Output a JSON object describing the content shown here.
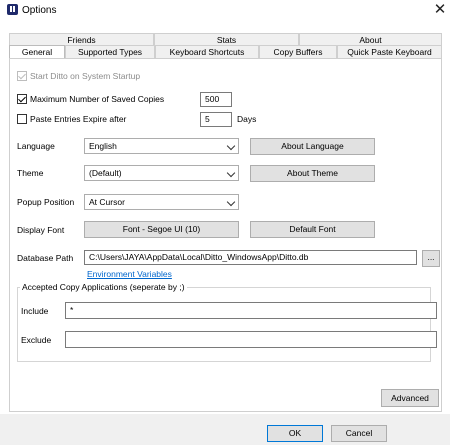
{
  "window": {
    "title": "Options",
    "close_glyph": "✕"
  },
  "tabs_row1": [
    "Friends",
    "Stats",
    "About"
  ],
  "tabs_row2": [
    "General",
    "Supported Types",
    "Keyboard Shortcuts",
    "Copy Buffers",
    "Quick Paste Keyboard"
  ],
  "active_tab": "General",
  "general": {
    "start_on_startup": {
      "label": "Start Ditto on System Startup",
      "checked": true,
      "disabled": true
    },
    "max_saved": {
      "label": "Maximum Number of Saved Copies",
      "checked": true,
      "value": "500"
    },
    "expire": {
      "label": "Paste Entries Expire after",
      "checked": false,
      "value": "5",
      "unit": "Days"
    },
    "language": {
      "label": "Language",
      "value": "English",
      "button": "About Language"
    },
    "theme": {
      "label": "Theme",
      "value": "(Default)",
      "button": "About Theme"
    },
    "popup": {
      "label": "Popup Position",
      "value": "At Cursor"
    },
    "font": {
      "label": "Display Font",
      "value": "Font - Segoe UI (10)",
      "button": "Default Font"
    },
    "db": {
      "label": "Database Path",
      "value": "C:\\Users\\JAYA\\AppData\\Local\\Ditto_WindowsApp\\Ditto.db",
      "browse": "...",
      "link": "Environment Variables"
    },
    "accepted": {
      "title": "Accepted Copy Applications (seperate by ;)",
      "include_label": "Include",
      "include_value": "*",
      "exclude_label": "Exclude",
      "exclude_value": ""
    },
    "advanced_button": "Advanced"
  },
  "footer": {
    "ok": "OK",
    "cancel": "Cancel"
  }
}
